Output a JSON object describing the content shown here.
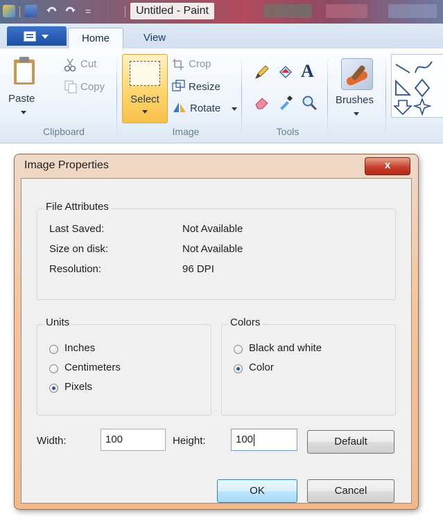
{
  "window": {
    "title": "Untitled - Paint"
  },
  "ribbon": {
    "tabs": [
      "Home",
      "View"
    ],
    "clipboard": {
      "paste": "Paste",
      "cut": "Cut",
      "copy": "Copy",
      "group": "Clipboard"
    },
    "image": {
      "select": "Select",
      "crop": "Crop",
      "resize": "Resize",
      "rotate": "Rotate",
      "group": "Image"
    },
    "tools": {
      "group": "Tools",
      "text_glyph": "A"
    },
    "brushes": "Brushes"
  },
  "dialog": {
    "title": "Image Properties",
    "close_glyph": "x",
    "file_attributes": {
      "heading": "File Attributes",
      "rows": [
        {
          "label": "Last Saved:",
          "value": "Not Available"
        },
        {
          "label": "Size on disk:",
          "value": "Not Available"
        },
        {
          "label": "Resolution:",
          "value": "96 DPI"
        }
      ]
    },
    "units": {
      "heading": "Units",
      "options": [
        "Inches",
        "Centimeters",
        "Pixels"
      ],
      "selected": "Pixels"
    },
    "colors": {
      "heading": "Colors",
      "options": [
        "Black and white",
        "Color"
      ],
      "selected": "Color"
    },
    "width_label": "Width:",
    "width_value": "100",
    "height_label": "Height:",
    "height_value": "100",
    "default_button": "Default",
    "ok_button": "OK",
    "cancel_button": "Cancel"
  }
}
